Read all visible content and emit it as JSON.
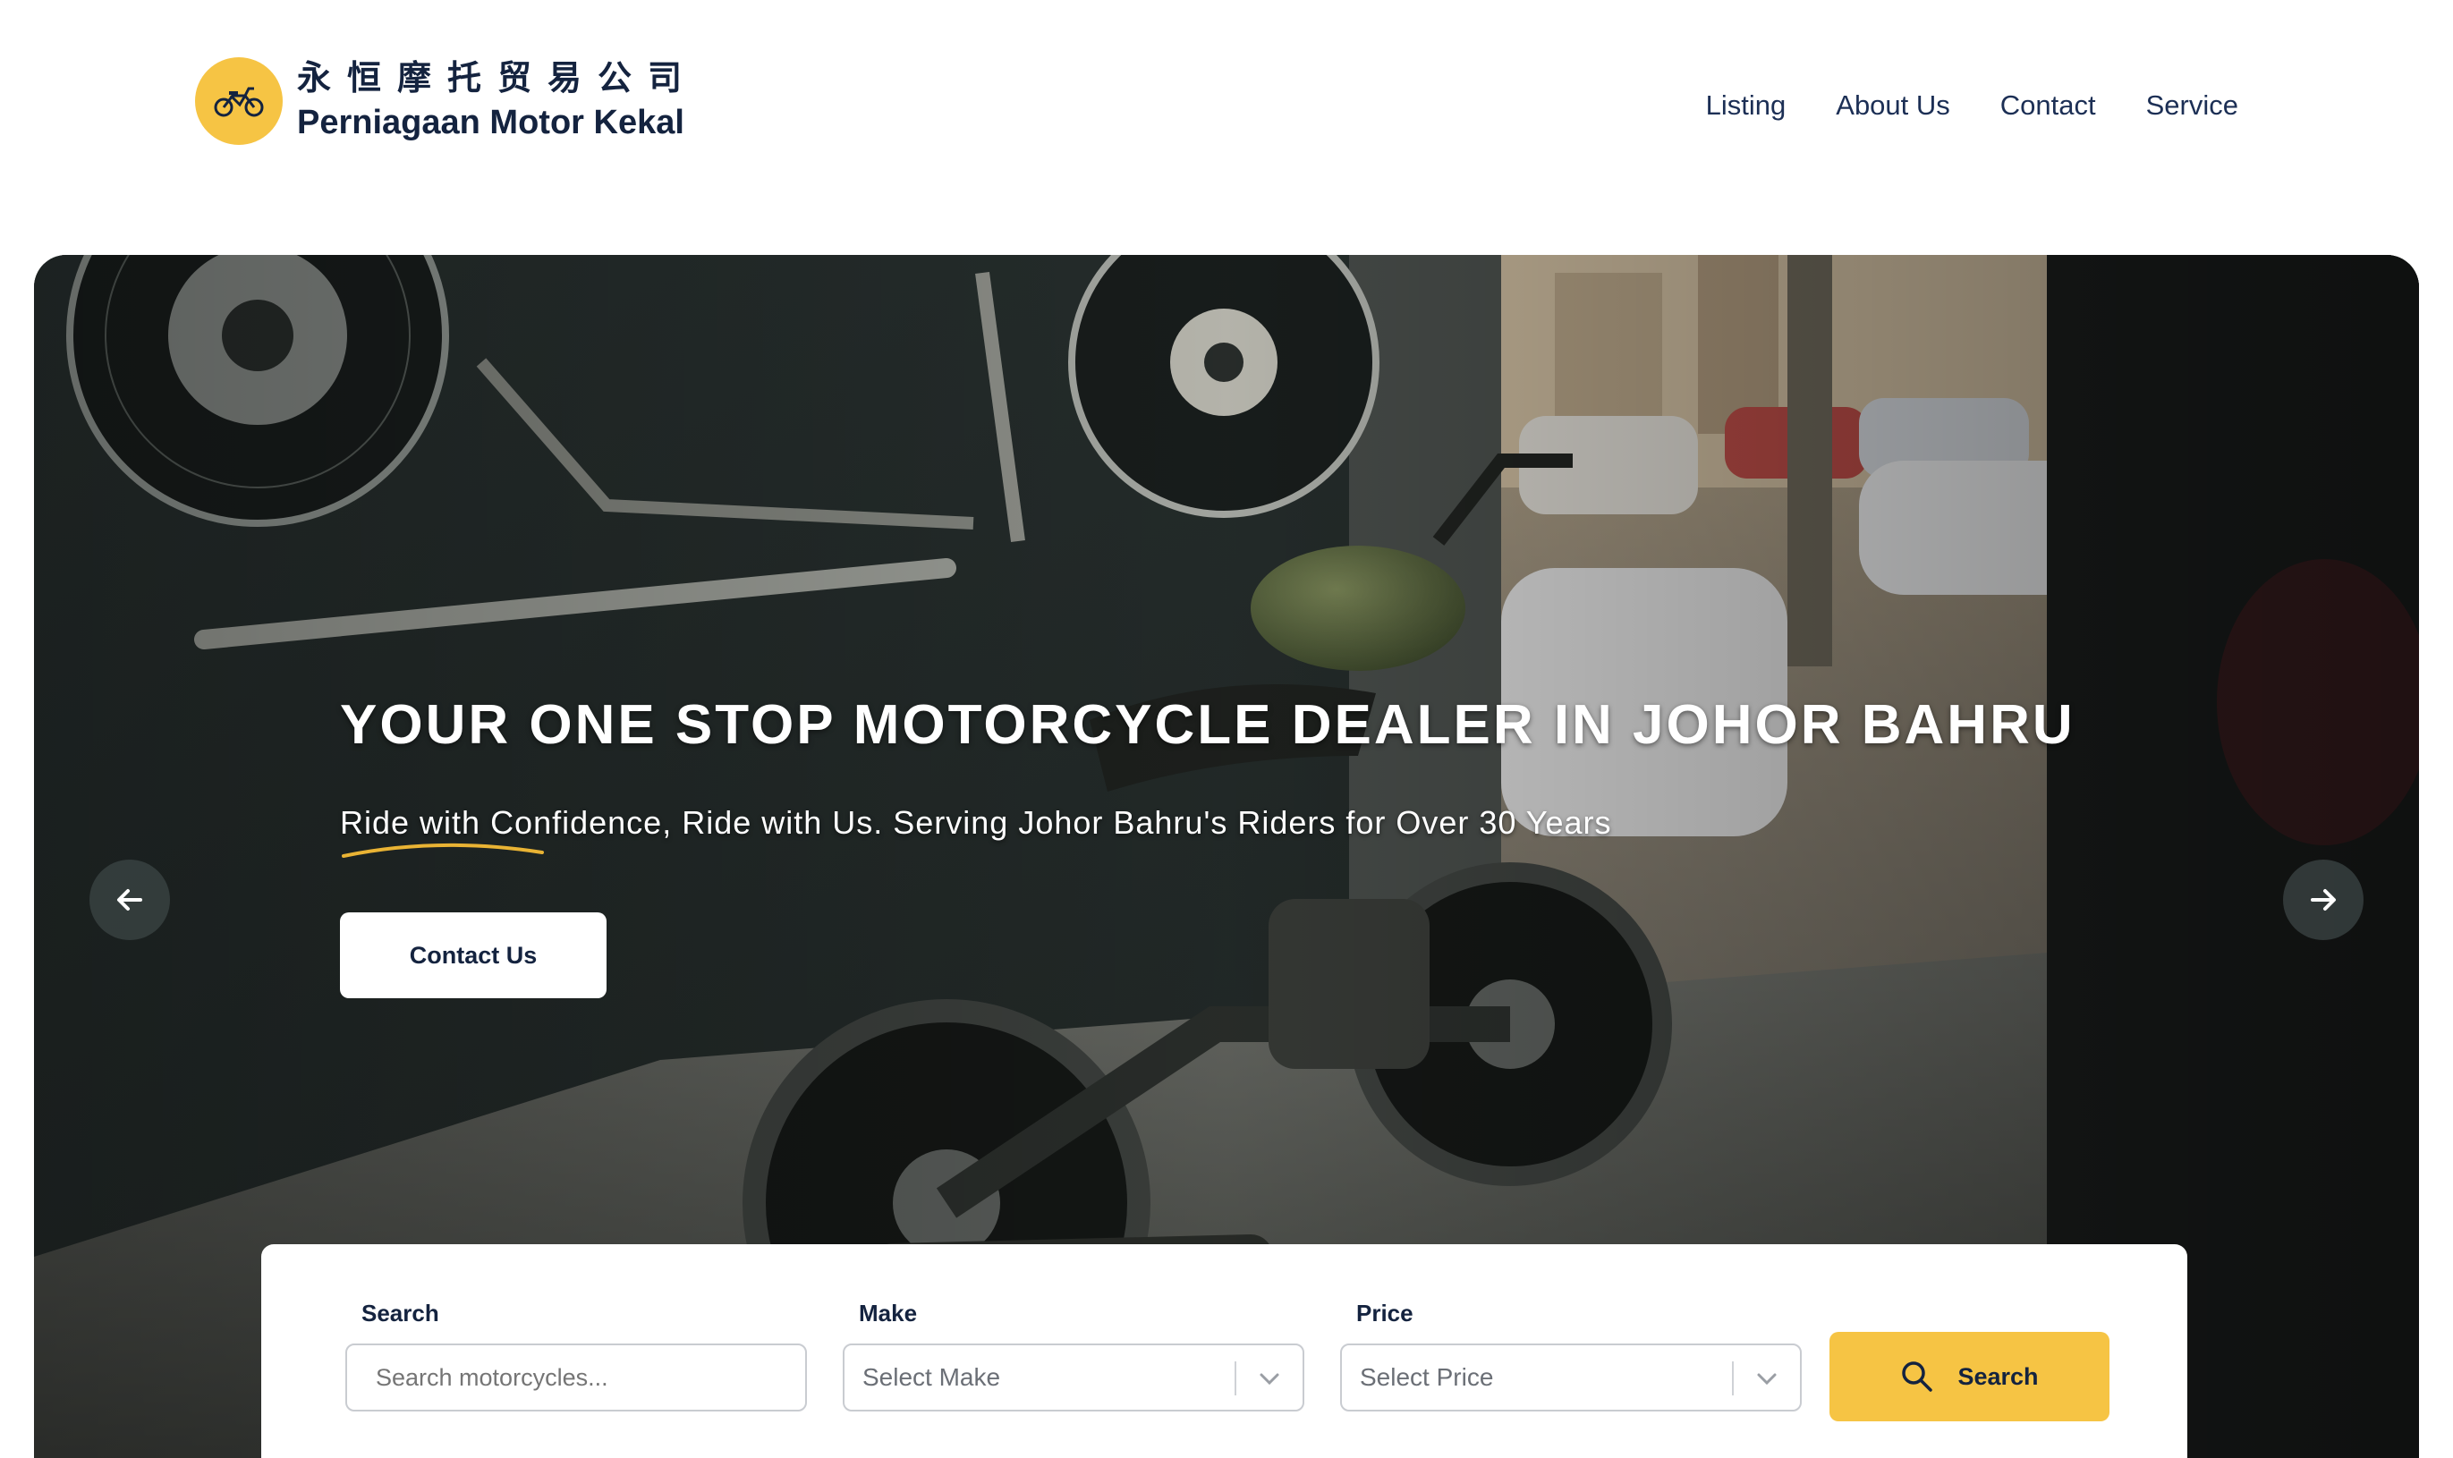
{
  "header": {
    "logo_cn": "永恒摩托贸易公司",
    "logo_en": "Perniagaan Motor Kekal",
    "nav": [
      "Listing",
      "About Us",
      "Contact",
      "Service"
    ]
  },
  "hero": {
    "title": "YOUR ONE STOP MOTORCYCLE DEALER IN JOHOR BAHRU",
    "subtitle": "Ride with Confidence, Ride with Us. Serving Johor Bahru's Riders for Over 30 Years",
    "cta_label": "Contact Us"
  },
  "search": {
    "search_label": "Search",
    "search_placeholder": "Search motorcycles...",
    "make_label": "Make",
    "make_value": "Select Make",
    "price_label": "Price",
    "price_value": "Select Price",
    "button_label": "Search"
  },
  "colors": {
    "accent": "#f6c444",
    "navy": "#14233f"
  }
}
